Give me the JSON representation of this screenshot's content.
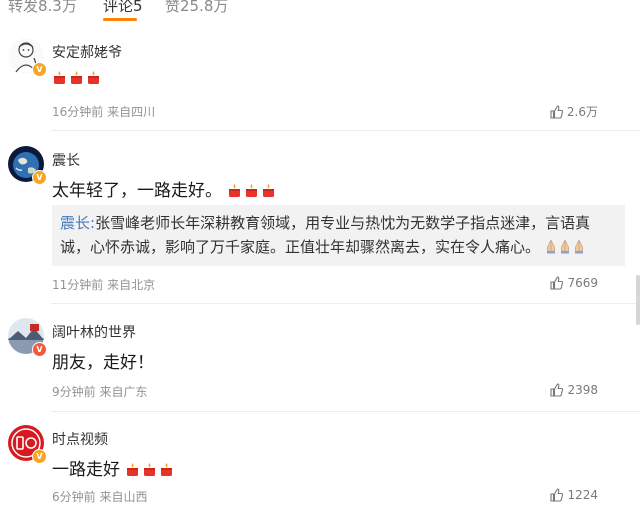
{
  "tabs": [
    {
      "label": "转发8.3万",
      "active": false
    },
    {
      "label": "评论5",
      "active": true
    },
    {
      "label": "赞25.8万",
      "active": false
    }
  ],
  "accent_color": "#ff8200",
  "comments": [
    {
      "username": "安定郝姥爷",
      "text": "",
      "candles": 3,
      "meta": "16分钟前  来自四川",
      "likes": "2.6万",
      "badge": "v-gold",
      "avatar": "cartoon-doctor"
    },
    {
      "username": "震长",
      "text": "太年轻了，一路走好。",
      "candles": 3,
      "quote_author": "震长:",
      "quote_text": "张雪峰老师长年深耕教育领域，用专业与热忱为无数学子指点迷津，言语真诚，心怀赤诚，影响了万千家庭。正值壮年却骤然离去，实在令人痛心。",
      "quote_emoji_count": 3,
      "meta": "11分钟前  来自北京",
      "likes": "7669",
      "badge": "v-gold",
      "avatar": "earth-globe"
    },
    {
      "username": "阔叶林的世界",
      "text": "朋友，走好！",
      "candles": 0,
      "meta": "9分钟前  来自广东",
      "likes": "2398",
      "badge": "v-red",
      "avatar": "landscape"
    },
    {
      "username": "时点视频",
      "text": "一路走好",
      "candles": 3,
      "meta": "6分钟前  来自山西",
      "likes": "1224",
      "badge": "v-gold",
      "avatar": "brand-logo"
    }
  ]
}
